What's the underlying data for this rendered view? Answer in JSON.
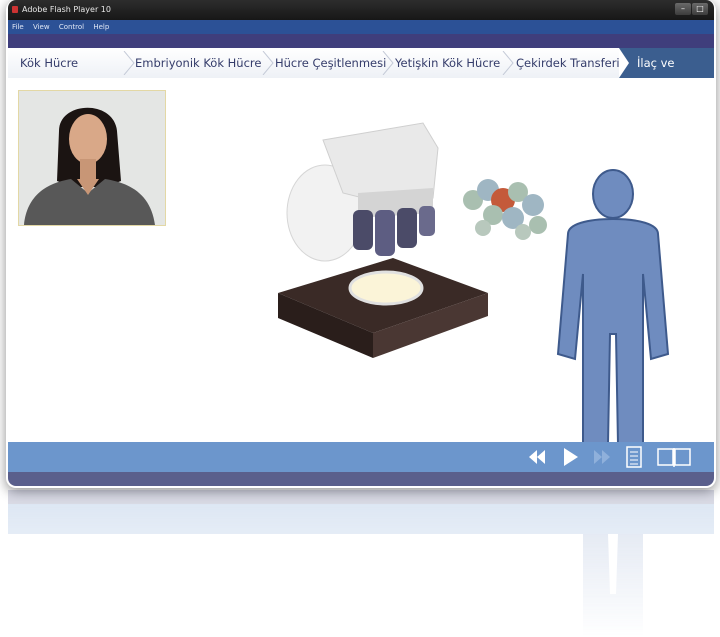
{
  "window": {
    "title": "Adobe Flash Player 10",
    "controls": {
      "minimize": "–",
      "maximize": "□"
    }
  },
  "menu": {
    "items": [
      "File",
      "View",
      "Control",
      "Help"
    ]
  },
  "breadcrumbs": {
    "items": [
      {
        "label": "Kök  Hücre"
      },
      {
        "label": "Embriyonik Kök Hücre"
      },
      {
        "label": "Hücre Çeşitlenmesi"
      },
      {
        "label": "Yetişkin Kök Hücre"
      },
      {
        "label": "Çekirdek Transferi"
      }
    ],
    "active": "İlaç ve Tedavi"
  },
  "colors": {
    "accent": "#3b5e8f",
    "footer": "#6c96cc",
    "band": "#3f3e7c",
    "menubar": "#2c5196",
    "figure": "#6f8cbf"
  },
  "controls": {
    "icons": [
      "rewind-icon",
      "play-icon",
      "forward-icon",
      "page-icon",
      "book-icon"
    ]
  }
}
